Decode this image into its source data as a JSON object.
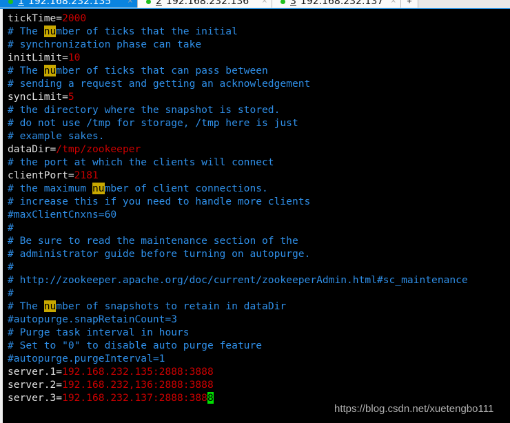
{
  "tabs": [
    {
      "num": "1",
      "label": "192.168.232.135",
      "active": true
    },
    {
      "num": "2",
      "label": "192.168.232.136",
      "active": false
    },
    {
      "num": "3",
      "label": "192.168.232.137",
      "active": false
    }
  ],
  "colors": {
    "key": "#e0e0e0",
    "value": "#cc0000",
    "comment": "#2f8fe8",
    "search_highlight": "#c8a800",
    "cursor": "#00e000",
    "tab_active": "#0a84e0"
  },
  "lines": [
    [
      [
        "w",
        "tickTime="
      ],
      [
        "r",
        "2000"
      ]
    ],
    [
      [
        "c",
        "# The "
      ],
      [
        "hl",
        "nu"
      ],
      [
        "c",
        "mber of ticks that the initial"
      ]
    ],
    [
      [
        "c",
        "# synchronization phase can take"
      ]
    ],
    [
      [
        "w",
        "initLimit="
      ],
      [
        "r",
        "10"
      ]
    ],
    [
      [
        "c",
        "# The "
      ],
      [
        "hl",
        "nu"
      ],
      [
        "c",
        "mber of ticks that can pass between"
      ]
    ],
    [
      [
        "c",
        "# sending a request and getting an acknowledgement"
      ]
    ],
    [
      [
        "w",
        "syncLimit="
      ],
      [
        "r",
        "5"
      ]
    ],
    [
      [
        "c",
        "# the directory where the snapshot is stored."
      ]
    ],
    [
      [
        "c",
        "# do not use /tmp for storage, /tmp here is just"
      ]
    ],
    [
      [
        "c",
        "# example sakes."
      ]
    ],
    [
      [
        "w",
        "dataDir="
      ],
      [
        "r",
        "/tmp/zookeeper"
      ]
    ],
    [
      [
        "c",
        "# the port at which the clients will connect"
      ]
    ],
    [
      [
        "w",
        "clientPort="
      ],
      [
        "r",
        "2181"
      ]
    ],
    [
      [
        "c",
        "# the maximum "
      ],
      [
        "hl",
        "nu"
      ],
      [
        "c",
        "mber of client connections."
      ]
    ],
    [
      [
        "c",
        "# increase this if you need to handle more clients"
      ]
    ],
    [
      [
        "c",
        "#maxClientCnxns=60"
      ]
    ],
    [
      [
        "c",
        "#"
      ]
    ],
    [
      [
        "c",
        "# Be sure to read the maintenance section of the"
      ]
    ],
    [
      [
        "c",
        "# administrator guide before turning on autopurge."
      ]
    ],
    [
      [
        "c",
        "#"
      ]
    ],
    [
      [
        "c",
        "# http://zookeeper.apache.org/doc/current/zookeeperAdmin.html#sc_maintenance"
      ]
    ],
    [
      [
        "c",
        "#"
      ]
    ],
    [
      [
        "c",
        "# The "
      ],
      [
        "hl",
        "nu"
      ],
      [
        "c",
        "mber of snapshots to retain in dataDir"
      ]
    ],
    [
      [
        "c",
        "#autopurge.snapRetainCount=3"
      ]
    ],
    [
      [
        "c",
        "# Purge task interval in hours"
      ]
    ],
    [
      [
        "c",
        "# Set to \"0\" to disable auto purge feature"
      ]
    ],
    [
      [
        "c",
        "#autopurge.purgeInterval=1"
      ]
    ],
    [
      [
        "w",
        "server.1="
      ],
      [
        "r",
        "192.168.232.135:2888:3888"
      ]
    ],
    [
      [
        "w",
        "server.2="
      ],
      [
        "r",
        "192.168.232,136:2888:3888"
      ]
    ],
    [
      [
        "w",
        "server.3="
      ],
      [
        "r",
        "192.168.232.137:2888:388"
      ],
      [
        "cur",
        "8"
      ]
    ]
  ],
  "watermark": "https://blog.csdn.net/xuetengbo111"
}
